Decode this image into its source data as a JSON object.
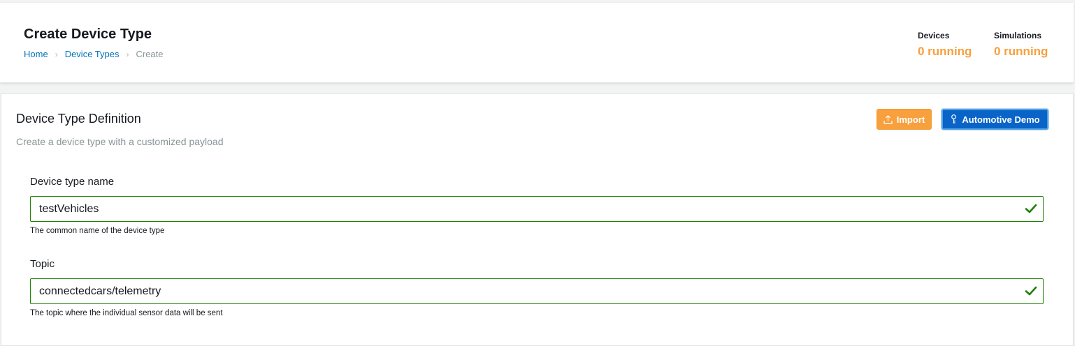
{
  "header": {
    "title": "Create Device Type",
    "breadcrumb": {
      "home": "Home",
      "device_types": "Device Types",
      "current": "Create",
      "separator": "›"
    },
    "stats": {
      "devices_label": "Devices",
      "devices_value": "0 running",
      "simulations_label": "Simulations",
      "simulations_value": "0 running"
    }
  },
  "definition": {
    "title": "Device Type Definition",
    "subtitle": "Create a device type with a customized payload",
    "import_label": "Import",
    "demo_label": "Automotive Demo",
    "fields": {
      "name": {
        "label": "Device type name",
        "value": "testVehicles",
        "hint": "The common name of the device type"
      },
      "topic": {
        "label": "Topic",
        "value": "connectedcars/telemetry",
        "hint": "The topic where the individual sensor data will be sent"
      }
    }
  },
  "colors": {
    "accent_orange": "#f7a03d",
    "primary_blue": "#0a64c8",
    "link_blue": "#0073bb",
    "valid_green": "#1d8102"
  },
  "icons": {
    "import": "upload-icon",
    "demo": "car-key-icon",
    "valid": "checkmark-icon"
  }
}
